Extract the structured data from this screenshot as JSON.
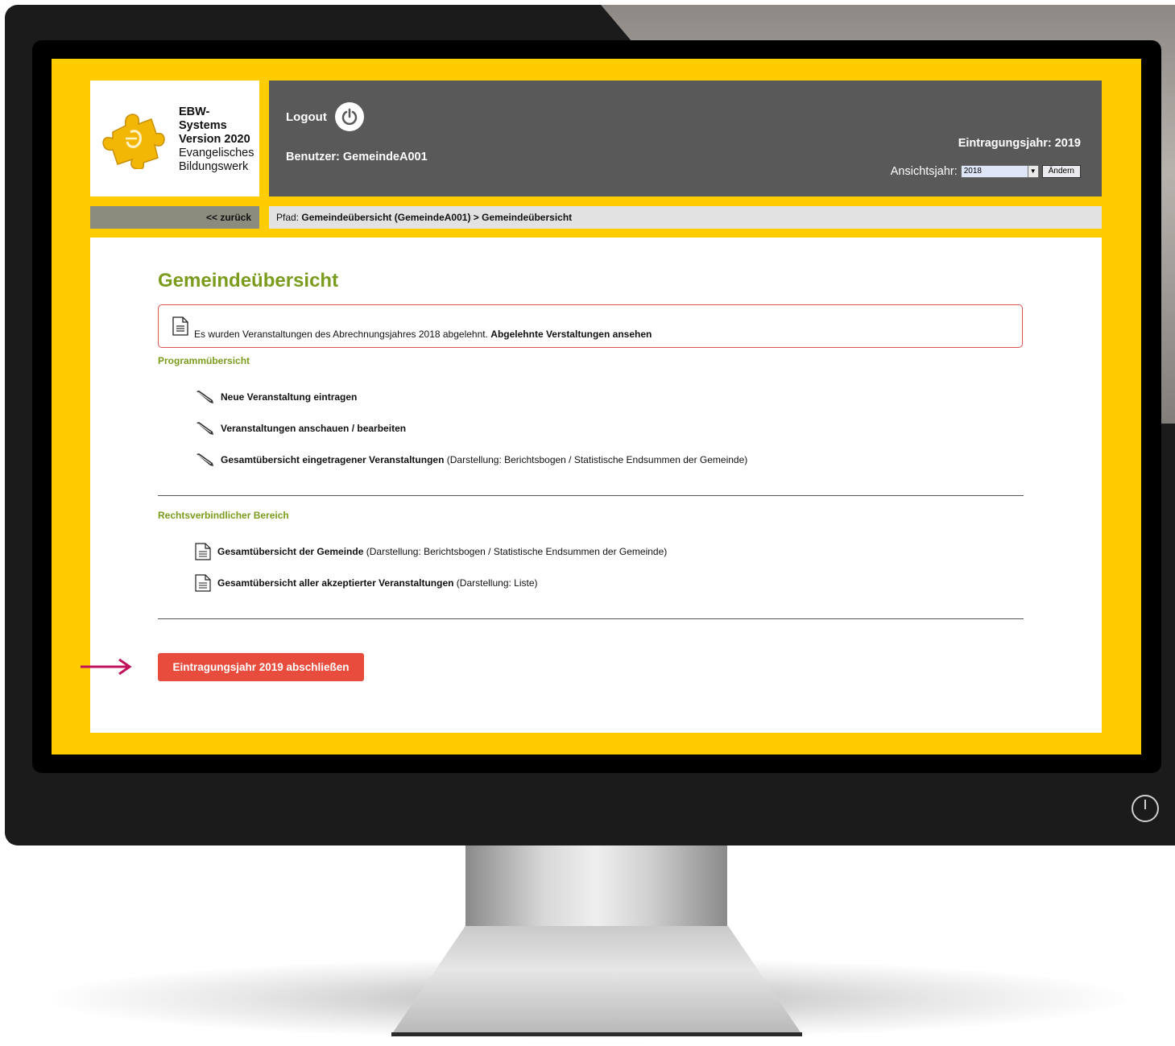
{
  "logo": {
    "line1": "EBW-",
    "line2": "Systems",
    "line3": "Version 2020",
    "line4": "Evangelisches",
    "line5": "Bildungswerk"
  },
  "header": {
    "logout_label": "Logout",
    "user_label": "Benutzer: GemeindeA001",
    "entry_year_label": "Eintragungsjahr: 2019",
    "view_year_label": "Ansichtsjahr:",
    "view_year_value": "2018",
    "change_button_label": "Ändern"
  },
  "nav": {
    "back_label": "<< zurück",
    "path_prefix": "Pfad:",
    "path_value": "Gemeindeübersicht (GemeindeA001) > Gemeindeübersicht"
  },
  "main": {
    "title": "Gemeindeübersicht",
    "alert": {
      "text": "Es wurden Veranstaltungen des Abrechnungsjahres 2018 abgelehnt.",
      "link": "Abgelehnte Verstaltungen ansehen"
    },
    "program_section": {
      "heading": "Programmübersicht",
      "items": [
        {
          "label": "Neue Veranstaltung eintragen",
          "note": ""
        },
        {
          "label": "Veranstaltungen anschauen / bearbeiten",
          "note": ""
        },
        {
          "label": "Gesamtübersicht eingetragener Veranstaltungen",
          "note": "(Darstellung: Berichtsbogen / Statistische Endsummen der Gemeinde)"
        }
      ]
    },
    "legal_section": {
      "heading": "Rechtsverbindlicher Bereich",
      "items": [
        {
          "label": "Gesamtübersicht der Gemeinde",
          "note": "(Darstellung: Berichtsbogen / Statistische Endsummen der Gemeinde)"
        },
        {
          "label": "Gesamtübersicht aller akzeptierter Veranstaltungen",
          "note": "(Darstellung: Liste)"
        }
      ]
    },
    "close_button_label": "Eintragungsjahr 2019 abschließen"
  },
  "colors": {
    "screen_bg": "#ffcc00",
    "header_bg": "#595959",
    "title_green": "#7a9b1b",
    "alert_red": "#d9534f",
    "button_red": "#e74c3c",
    "arrow_magenta": "#c0125b"
  }
}
